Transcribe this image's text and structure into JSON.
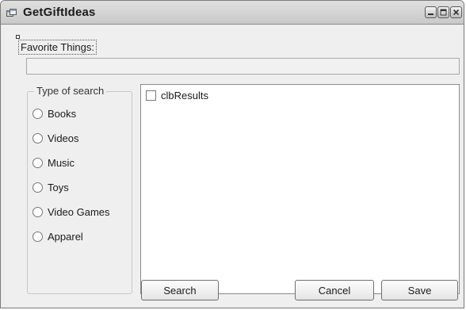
{
  "window": {
    "title": "GetGiftIdeas"
  },
  "favorites": {
    "label": "Favorite Things:",
    "value": ""
  },
  "search_type": {
    "legend": "Type of search",
    "options": [
      "Books",
      "Videos",
      "Music",
      "Toys",
      "Video Games",
      "Apparel"
    ]
  },
  "results": {
    "items": [
      "clbResults"
    ]
  },
  "buttons": {
    "search": "Search",
    "cancel": "Cancel",
    "save": "Save"
  },
  "icons": {
    "app": "app-form-icon",
    "minimize": "minimize-icon",
    "maximize": "maximize-icon",
    "close": "close-icon"
  },
  "colors": {
    "titlebar": "#cccccc",
    "client_bg": "#efefef",
    "list_bg": "#ffffff"
  }
}
